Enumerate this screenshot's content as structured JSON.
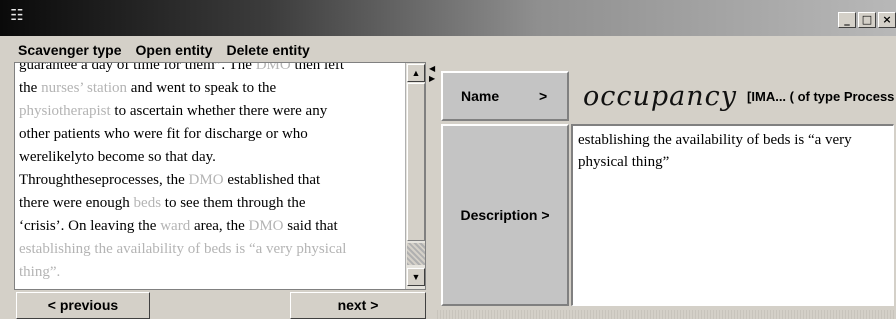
{
  "window": {
    "title": "",
    "icon": "app-icon",
    "controls": {
      "minimize": "_",
      "maximize": "□",
      "close": "×"
    }
  },
  "menu": {
    "items": [
      {
        "label": "Scavenger type"
      },
      {
        "label": "Open entity"
      },
      {
        "label": "Delete entity"
      }
    ]
  },
  "text_pane": {
    "lines": [
      [
        {
          "t": "guarantee a day of time for them”. The ",
          "e": false
        },
        {
          "t": "DMO",
          "e": true
        },
        {
          "t": " then left",
          "e": false
        }
      ],
      [
        {
          "t": "the ",
          "e": false
        },
        {
          "t": "nurses’ station",
          "e": true
        },
        {
          "t": " and went to speak to the",
          "e": false
        }
      ],
      [
        {
          "t": "physiotherapist",
          "e": true
        },
        {
          "t": " to ascertain whether there were any",
          "e": false
        }
      ],
      [
        {
          "t": "other patients who were fit for discharge or who",
          "e": false
        }
      ],
      [
        {
          "t": "werelikelyto become so that day.",
          "e": false
        }
      ],
      [
        {
          "t": "Throughtheseprocesses, the ",
          "e": false
        },
        {
          "t": "DMO",
          "e": true
        },
        {
          "t": " established that",
          "e": false
        }
      ],
      [
        {
          "t": "there were enough ",
          "e": false
        },
        {
          "t": "beds",
          "e": true
        },
        {
          "t": " to see them through the",
          "e": false
        }
      ],
      [
        {
          "t": "‘crisis’. On leaving the ",
          "e": false
        },
        {
          "t": "ward",
          "e": true
        },
        {
          "t": " area, the ",
          "e": false
        },
        {
          "t": "DMO",
          "e": true
        },
        {
          "t": " said that",
          "e": false
        }
      ],
      [
        {
          "t": "establishing the availability of beds is “a very physical",
          "e": true
        }
      ],
      [
        {
          "t": "thing”.",
          "e": true
        }
      ]
    ],
    "entity_color": "#b4b4b4"
  },
  "nav": {
    "previous_label": "< previous",
    "next_label": "next >"
  },
  "entity": {
    "name_label": "Name",
    "name_arrow": ">",
    "name_handwritten": "occupancy",
    "name_type": "[IMA... ( of type Process )",
    "description_label": "Description >",
    "description_text": "establishing the availability of beds is “a very physical thing”"
  }
}
